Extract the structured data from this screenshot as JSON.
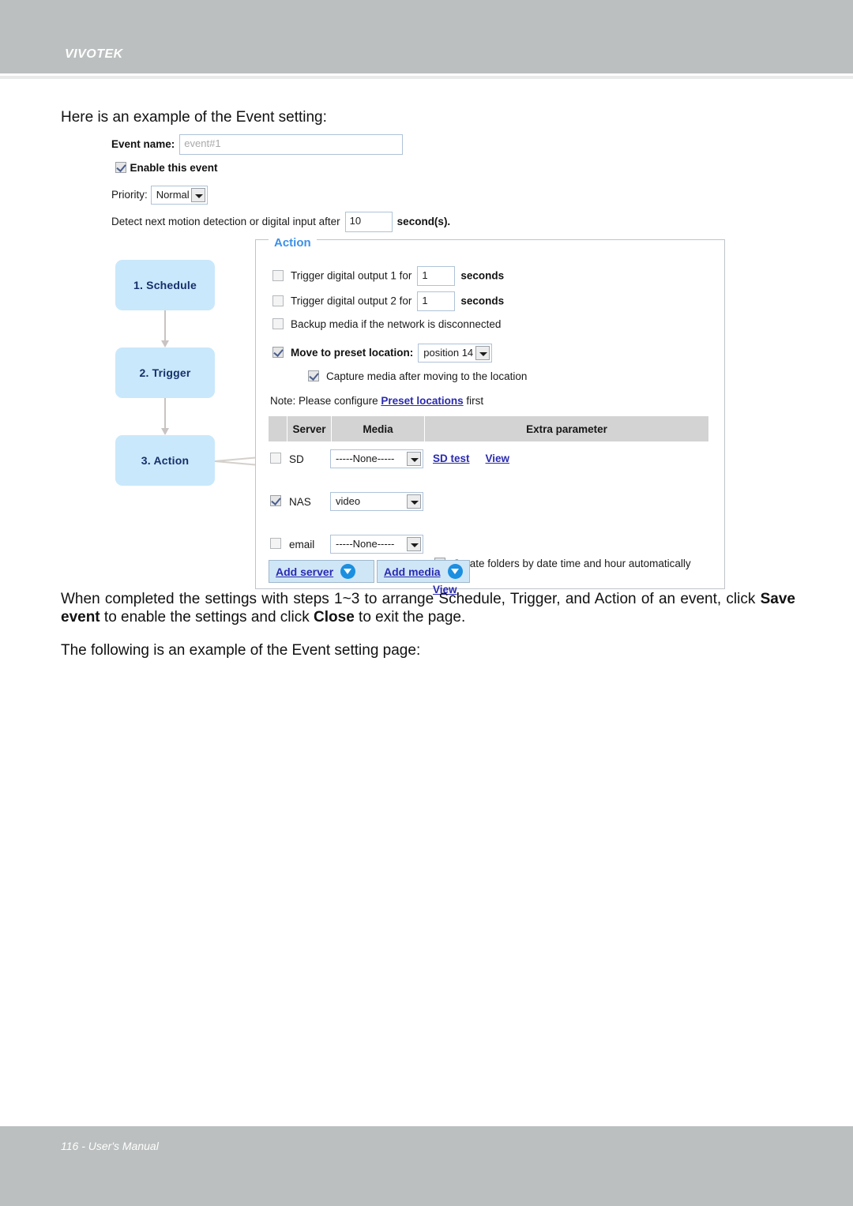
{
  "header": {
    "brand": "VIVOTEK"
  },
  "footer": {
    "text": "116 - User's Manual"
  },
  "page": {
    "intro": "Here is an example of the Event setting:",
    "para1_part1": "When completed the settings with steps 1~3 to arrange Schedule, Trigger, and Action of an event, click ",
    "para1_bold1": "Save event",
    "para1_part2": " to enable the settings and click ",
    "para1_bold2": "Close",
    "para1_part3": " to exit the page.",
    "para2": "The following is an example of the Event setting page:"
  },
  "form": {
    "event_name_label": "Event name:",
    "event_name_placeholder": "event#1",
    "event_name_value": "event#1",
    "enable_label": "Enable this event",
    "enable_checked": true,
    "priority_label": "Priority:",
    "priority_value": "Normal",
    "detect_prefix": "Detect next motion detection or digital input after",
    "detect_value": "10",
    "detect_suffix": "second(s)."
  },
  "flow": {
    "steps": [
      {
        "label": "1.  Schedule"
      },
      {
        "label": "2.  Trigger"
      },
      {
        "label": "3.  Action"
      }
    ]
  },
  "action": {
    "legend": "Action",
    "do1_label": "Trigger digital output 1 for",
    "do1_value": "1",
    "do1_unit": "seconds",
    "do1_checked": false,
    "do2_label": "Trigger digital output 2 for",
    "do2_value": "1",
    "do2_unit": "seconds",
    "do2_checked": false,
    "backup_label": "Backup media if the network is disconnected",
    "backup_checked": false,
    "preset_label": "Move to preset location:",
    "preset_value": "position 14",
    "preset_checked": true,
    "capture_label": "Capture media after moving to the location",
    "capture_checked": true,
    "note_prefix": "Note: Please configure ",
    "note_link": "Preset locations",
    "note_suffix": " first"
  },
  "table": {
    "columns": [
      "",
      "Server",
      "Media",
      "Extra parameter"
    ],
    "rows": [
      {
        "checked": false,
        "server": "SD",
        "media": "-----None-----",
        "links": [
          "SD test",
          "View"
        ]
      },
      {
        "checked": true,
        "server": "NAS",
        "media": "video",
        "extra_checkbox_label": "Create folders by date time and hour automatically",
        "extra_checkbox_checked": true,
        "links": [
          "View"
        ]
      },
      {
        "checked": false,
        "server": "email",
        "media": "-----None-----",
        "links": []
      }
    ]
  },
  "buttons": {
    "add_server": "Add server",
    "add_media": "Add media"
  },
  "colors": {
    "band": "#bcbfbf",
    "flow_box": "#c9e8fb",
    "legend_blue": "#3c90e8",
    "link_blue": "#2a2ab0",
    "button_blue": "#1b8fe0",
    "table_header": "#d3d3d3"
  }
}
